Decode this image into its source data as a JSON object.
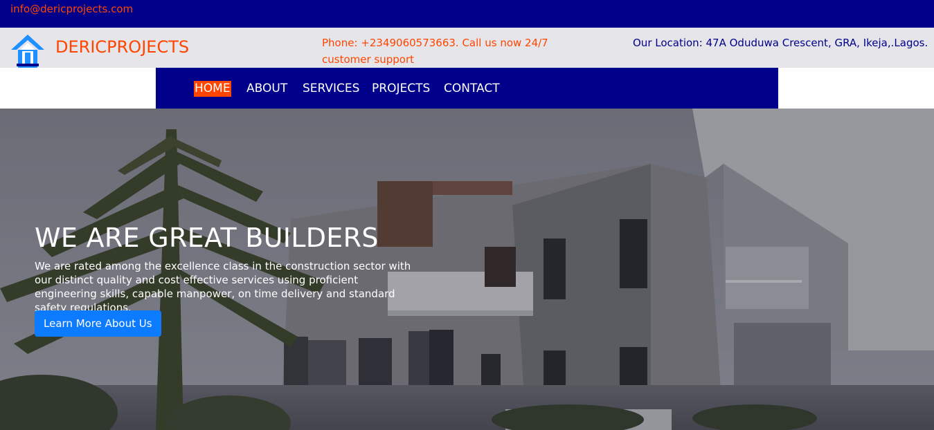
{
  "topbar": {
    "email": "info@dericprojects.com"
  },
  "header": {
    "brand": "DERICPROJECTS",
    "phone": "Phone: +2349060573663. Call us now 24/7 customer support",
    "location": "Our Location: 47A Oduduwa Crescent, GRA, Ikeja,.Lagos."
  },
  "nav": {
    "items": [
      {
        "label": "HOME",
        "active": true
      },
      {
        "label": "ABOUT"
      },
      {
        "label": "SERVICES"
      },
      {
        "label": "PROJECTS"
      },
      {
        "label": "CONTACT"
      }
    ]
  },
  "hero": {
    "title": "WE ARE GREAT BUILDERS",
    "text": "We are rated among the excellence class in the construction sector with our distinct quality and cost effective services using proficient engineering skills, capable manpower, on time delivery and standard safety regulations.",
    "button": "Learn More About Us"
  },
  "colors": {
    "navy": "#00008b",
    "accent": "#ff4500",
    "button": "#0d7bff",
    "infobar": "#e6e6ea"
  }
}
